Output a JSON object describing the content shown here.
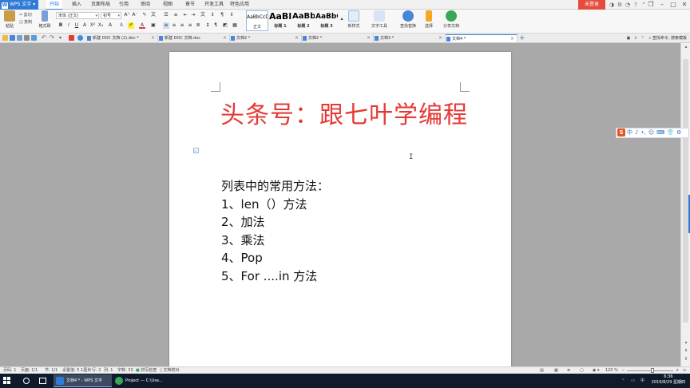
{
  "menubar": {
    "app_name": "WPS 文字",
    "tabs": [
      "开始",
      "插入",
      "页面布局",
      "引用",
      "审阅",
      "视图",
      "章节",
      "开发工具",
      "特色应用"
    ],
    "active_tab": "开始",
    "login": "未登录"
  },
  "ribbon": {
    "paste": "粘贴",
    "cut": "剪切",
    "copy": "复制",
    "format_painter": "格式刷",
    "font_name": "宋体 (正文)",
    "font_size": "初号",
    "styles": [
      {
        "preview": "AaBbCcDd",
        "label": "正文"
      },
      {
        "preview": "AaBl",
        "label": "标题 1"
      },
      {
        "preview": "AaBb(",
        "label": "标题 2"
      },
      {
        "preview": "AaBbC",
        "label": "标题 3"
      }
    ],
    "new_style": "新样式",
    "text_tools": "文字工具",
    "find_replace": "查找替换",
    "select": "选择",
    "share_doc": "分享文档"
  },
  "tabs": {
    "documents": [
      {
        "name": "新建 DOC 文档 (2).doc *"
      },
      {
        "name": "新建 DOC 文档.doc"
      },
      {
        "name": "文档2 *"
      },
      {
        "name": "文档2 *"
      },
      {
        "name": "文档3 *"
      },
      {
        "name": "文档4 *"
      }
    ],
    "active_index": 5,
    "find_cmd": "查找命令",
    "search_template": "搜索模板"
  },
  "document": {
    "title": "头条号：跟七叶学编程",
    "lines": [
      "列表中的常用方法：",
      "1、len（）方法",
      "2、加法",
      "3、乘法",
      "4、Pop",
      "5、For ....in  方法"
    ]
  },
  "ime": {
    "items": [
      "中",
      "♪",
      "•,",
      "☺",
      "⌨",
      "👕",
      "⚙"
    ]
  },
  "statusbar": {
    "page_num": "页码: 1",
    "pages": "页面: 1/1",
    "section": "节: 1/1",
    "setting": "设置值: 5.1厘米",
    "row": "行: 2",
    "col": "列: 1",
    "words": "字数: 33",
    "spell_check": "拼写检查",
    "doc_check": "文档校对",
    "zoom": "120 %"
  },
  "taskbar": {
    "items": [
      {
        "label": "文档4 * - WPS 文字"
      },
      {
        "label": "Project --- C:\\Use..."
      }
    ],
    "ime_lang": "中",
    "time": "6:36",
    "date": "2019/8/29 星期四"
  }
}
